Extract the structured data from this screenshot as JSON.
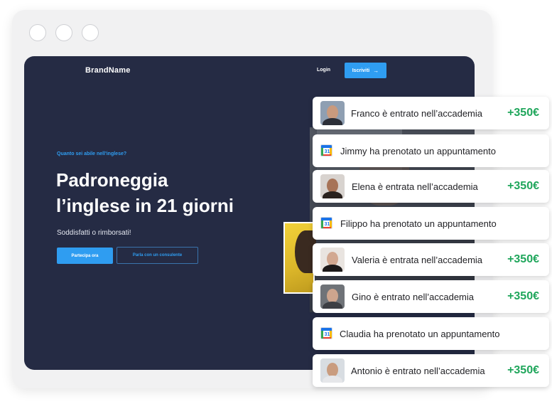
{
  "site": {
    "brand": "BrandName",
    "nav": {
      "login_label": "Login",
      "signup_label": "Iscriviti",
      "signup_icon": "arrow-right-icon"
    },
    "hero": {
      "eyebrow": "Quanto sei abile nell'inglese?",
      "title_line1": "Padroneggia",
      "title_line2": "l’inglese in 21 giorni",
      "subtitle": "Soddisfatti o rimborsati!",
      "cta_primary": "Partecipa ora",
      "cta_secondary": "Parla con un consulente"
    }
  },
  "notifications": [
    {
      "type": "join",
      "icon": "avatar-photo",
      "text": "Franco è entrato nell’accademia",
      "amount": "+350€"
    },
    {
      "type": "booking",
      "icon": "google-calendar-icon",
      "calendar_day": "31",
      "text": "Jimmy ha prenotato un appuntamento"
    },
    {
      "type": "join",
      "icon": "avatar-photo",
      "text": "Elena è entrata nell’accademia",
      "amount": "+350€"
    },
    {
      "type": "booking",
      "icon": "google-calendar-icon",
      "calendar_day": "31",
      "text": "Filippo ha prenotato un appuntamento"
    },
    {
      "type": "join",
      "icon": "avatar-photo",
      "text": "Valeria è entrata nell’accademia",
      "amount": "+350€"
    },
    {
      "type": "join",
      "icon": "avatar-photo",
      "text": "Gino è entrato nell’accademia",
      "amount": "+350€"
    },
    {
      "type": "booking",
      "icon": "google-calendar-icon",
      "calendar_day": "31",
      "text": "Claudia ha prenotato un appuntamento"
    },
    {
      "type": "join",
      "icon": "avatar-photo",
      "text": "Antonio è entrato nell’accademia",
      "amount": "+350€"
    }
  ],
  "colors": {
    "accent": "#2f9df1",
    "page_bg": "#252b44",
    "amount": "#1fa65b"
  }
}
